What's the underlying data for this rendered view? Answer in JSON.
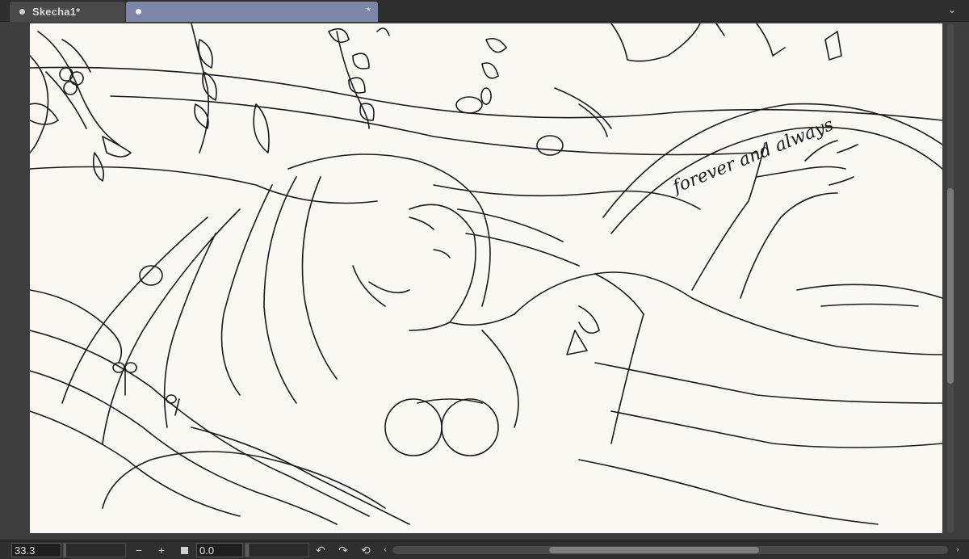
{
  "tabs": [
    {
      "label": "Skecha1*",
      "active": false
    },
    {
      "label": "",
      "modified_marker": "*",
      "active": true
    }
  ],
  "icons": {
    "tab_dot": "dot-icon",
    "tab_menu": "chevron-down-icon",
    "zoom_out": "minus-icon",
    "zoom_in": "plus-icon",
    "fit": "square-icon",
    "rotate_ccw": "rotate-left-icon",
    "rotate_cw": "rotate-right-icon",
    "rotate_reset": "reset-rotation-icon",
    "scroll_left": "chevron-left-icon",
    "scroll_right": "chevron-right-icon"
  },
  "canvas": {
    "handwritten_text": "forever and always"
  },
  "statusbar": {
    "zoom_value": "33.3",
    "angle_value": "0.0",
    "zoom_out_label": "−",
    "zoom_in_label": "+",
    "rotate_ccw_label": "↶",
    "rotate_cw_label": "↷",
    "rotate_reset_label": "⟲",
    "scroll_left_label": "‹",
    "scroll_right_label": "›",
    "tab_menu_label": "⌄"
  },
  "colors": {
    "canvas_bg": "#fbf8f3",
    "active_tab": "#7c86a8",
    "chrome_bg": "#2e2e2e",
    "ink": "#1a1a1a"
  }
}
